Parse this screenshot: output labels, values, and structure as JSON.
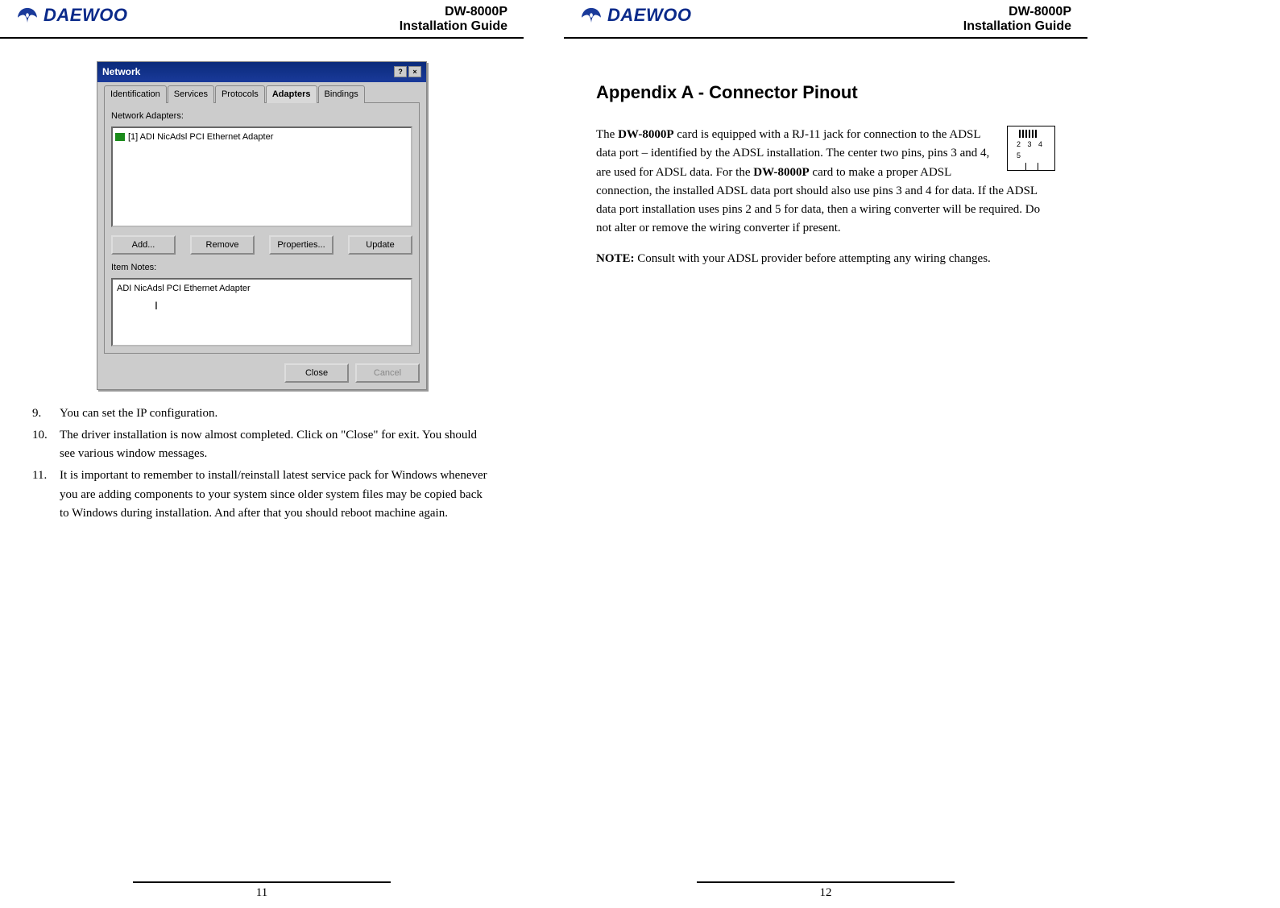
{
  "brand": "DAEWOO",
  "header": {
    "model": "DW-8000P",
    "subtitle": "Installation Guide"
  },
  "left": {
    "page_number": "11",
    "dialog": {
      "title": "Network",
      "tabs": [
        "Identification",
        "Services",
        "Protocols",
        "Adapters",
        "Bindings"
      ],
      "active_tab": "Adapters",
      "adapters_label": "Network Adapters:",
      "adapter_item": "[1] ADI NicAdsl PCI Ethernet Adapter",
      "btn_add": "Add...",
      "btn_remove": "Remove",
      "btn_properties": "Properties...",
      "btn_update": "Update",
      "notes_label": "Item Notes:",
      "notes_value": "ADI NicAdsl PCI Ethernet Adapter",
      "btn_close": "Close",
      "btn_cancel": "Cancel"
    },
    "steps": {
      "n9": "9.",
      "t9": "You can set the IP configuration.",
      "n10": "10.",
      "t10": "The driver installation is now almost completed. Click on \"Close\" for exit. You should see various window messages.",
      "n11": "11.",
      "t11": "It is important to remember to install/reinstall latest service pack for Windows whenever you are adding components to your system since older system files may be copied back to Windows during installation. And after that you should reboot machine again."
    }
  },
  "right": {
    "page_number": "12",
    "title": "Appendix A - Connector Pinout",
    "rj11_labels": "2 3 4 5",
    "p1a": "The ",
    "p1b": "DW-8000P",
    "p1c": " card is equipped with a RJ-11 jack for connection to the ADSL data port – identified by the ADSL installation. The center two pins, pins 3 and 4, are used for ADSL data. For the ",
    "p1d": "DW-8000P",
    "p1e": " card to make a proper ADSL connection, the installed ADSL data port should also use pins 3 and 4 for data. If the ADSL data port installation uses pins 2 and 5 for data, then a wiring converter will be required. Do not alter or remove the wiring converter if present.",
    "note_label": "NOTE:",
    "note_text": " Consult with your ADSL provider before attempting any wiring changes."
  }
}
